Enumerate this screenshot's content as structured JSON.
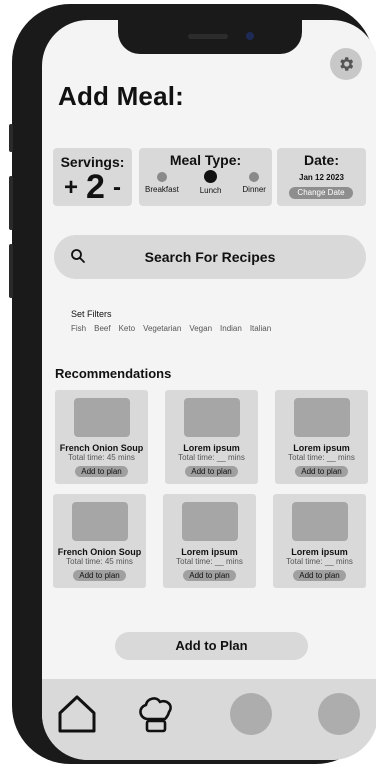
{
  "header": {
    "title": "Add Meal:"
  },
  "icons": {
    "settings": "gear-icon",
    "search": "search-icon",
    "home": "home-icon",
    "chef": "chef-hat-icon"
  },
  "servings": {
    "label": "Servings:",
    "plus": "+",
    "value": "2",
    "minus": "-"
  },
  "meal_type": {
    "label": "Meal Type:",
    "options": [
      {
        "label": "Breakfast",
        "selected": false
      },
      {
        "label": "Lunch",
        "selected": true
      },
      {
        "label": "Dinner",
        "selected": false
      }
    ]
  },
  "date": {
    "label": "Date:",
    "value": "Jan  12  2023",
    "change_label": "Change Date"
  },
  "search": {
    "label": "Search For Recipes"
  },
  "filters": {
    "title": "Set Filters",
    "items": [
      "Fish",
      "Beef",
      "Keto",
      "Vegetarian",
      "Vegan",
      "Indian",
      "Italian"
    ]
  },
  "recommendations": {
    "title": "Recommendations",
    "items": [
      {
        "name": "French Onion Soup",
        "time": "Total time: 45 mins",
        "add": "Add to plan"
      },
      {
        "name": "Lorem ipsum",
        "time": "Total time: __ mins",
        "add": "Add to plan"
      },
      {
        "name": "Lorem ipsum",
        "time": "Total time: __ mins",
        "add": "Add to plan"
      },
      {
        "name": "French Onion Soup",
        "time": "Total time: 45 mins",
        "add": "Add to plan"
      },
      {
        "name": "Lorem ipsum",
        "time": "Total time: __ mins",
        "add": "Add to plan"
      },
      {
        "name": "Lorem ipsum",
        "time": "Total time: __ mins",
        "add": "Add to plan"
      }
    ]
  },
  "actions": {
    "add_to_plan": "Add to Plan"
  }
}
